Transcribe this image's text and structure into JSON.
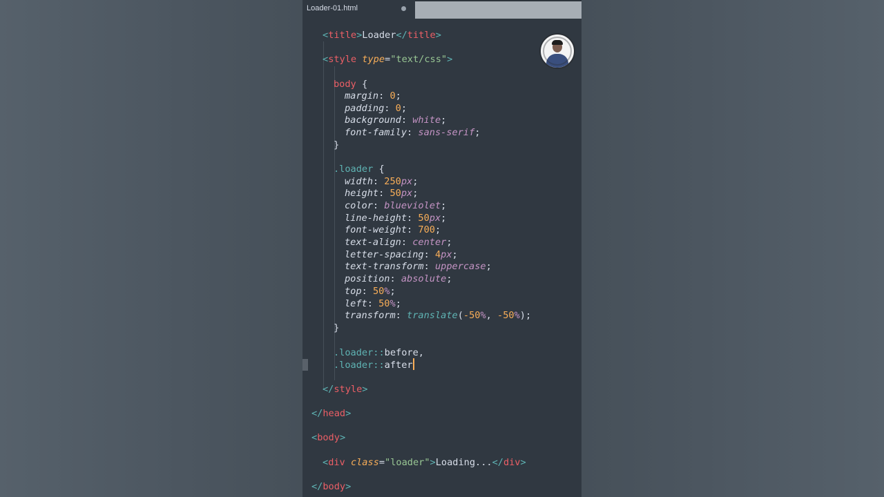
{
  "tab": {
    "title": "Loader-01.html"
  },
  "code": {
    "title_open": "<title>",
    "title_text": "Loader",
    "title_close": "</title>",
    "style_open_tag": "<style",
    "style_attr": "type",
    "style_eq": "=",
    "style_val": "\"text/css\"",
    "style_gt": ">",
    "body_sel": "body",
    "open_brace": "{",
    "close_brace": "}",
    "margin": "margin",
    "margin_val": "0",
    "padding": "padding",
    "padding_val": "0",
    "background": "background",
    "background_val": "white",
    "font_family": "font-family",
    "font_family_val": "sans-serif",
    "loader_sel": ".loader",
    "width": "width",
    "width_num": "250",
    "width_unit": "px",
    "height": "height",
    "height_num": "50",
    "height_unit": "px",
    "color": "color",
    "color_val": "blueviolet",
    "line_height": "line-height",
    "line_height_num": "50",
    "line_height_unit": "px",
    "font_weight": "font-weight",
    "font_weight_val": "700",
    "text_align": "text-align",
    "text_align_val": "center",
    "letter_spacing": "letter-spacing",
    "letter_spacing_num": "4",
    "letter_spacing_unit": "px",
    "text_transform": "text-transform",
    "text_transform_val": "uppercase",
    "position": "position",
    "position_val": "absolute",
    "top": "top",
    "top_num": "50",
    "top_unit": "%",
    "left": "left",
    "left_num": "50",
    "left_unit": "%",
    "transform": "transform",
    "transform_fn": "translate",
    "transform_a": "-50",
    "transform_b": "-50",
    "pct": "%",
    "before_sel": ".loader",
    "before_pseudo": "::",
    "before_word": "before",
    "comma": ",",
    "after_sel": ".loader",
    "after_pseudo": "::",
    "after_word": "after",
    "style_close": "</style>",
    "head_close": "</head>",
    "body_open": "<body>",
    "div_open": "<div",
    "div_attr": "class",
    "div_val": "\"loader\"",
    "div_gt": ">",
    "div_text": "Loading...",
    "div_close": "</div>",
    "body_close": "</body>",
    "colon": ":",
    "semi": ";"
  }
}
